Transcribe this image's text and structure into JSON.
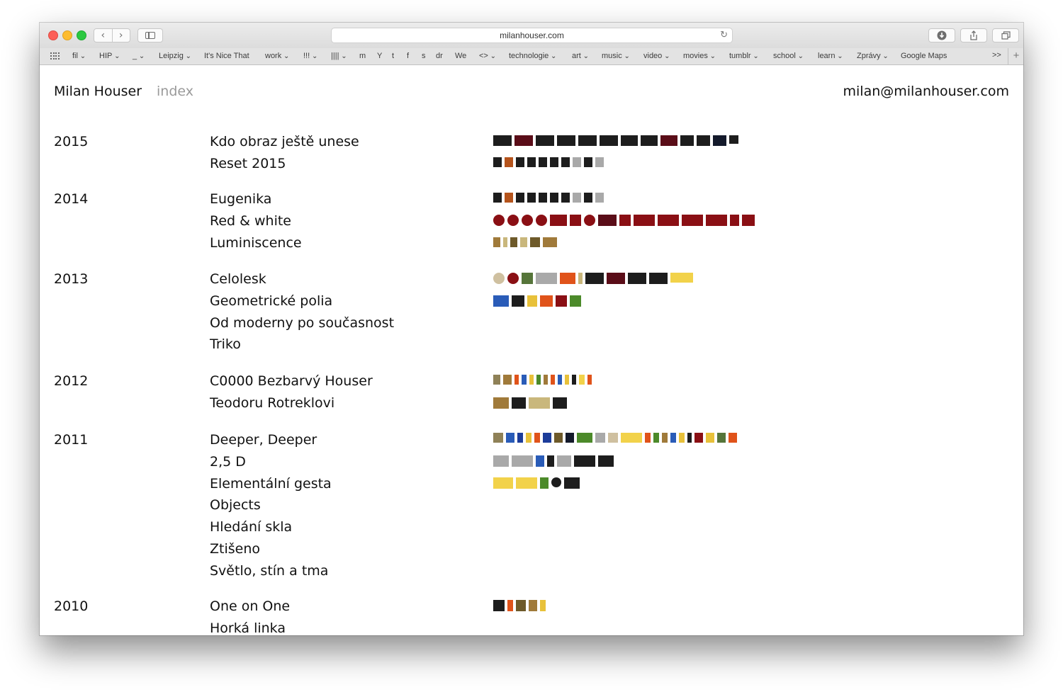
{
  "browser": {
    "url": "milanhouser.com",
    "bookmarks": [
      {
        "label": "fil",
        "dropdown": true
      },
      {
        "label": "HIP",
        "dropdown": true
      },
      {
        "label": "_",
        "dropdown": true
      },
      {
        "label": "Leipzig",
        "dropdown": true
      },
      {
        "label": "It's Nice That",
        "dropdown": false
      },
      {
        "label": "work",
        "dropdown": true
      },
      {
        "label": "!!!",
        "dropdown": true
      },
      {
        "label": "||||",
        "dropdown": true
      },
      {
        "label": "m",
        "dropdown": false
      },
      {
        "label": "Y",
        "dropdown": false
      },
      {
        "label": "t",
        "dropdown": false
      },
      {
        "label": "f",
        "dropdown": false
      },
      {
        "label": "s",
        "dropdown": false
      },
      {
        "label": "dr",
        "dropdown": false
      },
      {
        "label": "We",
        "dropdown": false
      },
      {
        "label": "<>",
        "dropdown": true
      },
      {
        "label": "technologie",
        "dropdown": true
      },
      {
        "label": "art",
        "dropdown": true
      },
      {
        "label": "music",
        "dropdown": true
      },
      {
        "label": "video",
        "dropdown": true
      },
      {
        "label": "movies",
        "dropdown": true
      },
      {
        "label": "tumblr",
        "dropdown": true
      },
      {
        "label": "school",
        "dropdown": true
      },
      {
        "label": "learn",
        "dropdown": true
      },
      {
        "label": "Zprávy",
        "dropdown": true
      },
      {
        "label": "Google Maps",
        "dropdown": false
      }
    ],
    "bookmarks_more": ">>",
    "icons": [
      "chevron-left-icon",
      "chevron-right-icon",
      "sidebar-icon",
      "reload-icon",
      "download-icon",
      "share-icon",
      "tabs-icon",
      "apps-grid-icon",
      "plus-icon"
    ]
  },
  "site": {
    "name": "Milan Houser",
    "nav": "index",
    "email": "milan@milanhouser.com"
  },
  "years": [
    {
      "year": "2015",
      "projects": [
        "Kdo obraz ještě unese",
        "Reset 2015"
      ]
    },
    {
      "year": "2014",
      "projects": [
        "Eugenika",
        "Red & white",
        "Luminiscence"
      ]
    },
    {
      "year": "2013",
      "projects": [
        "Celolesk",
        "Geometrické polia",
        "Od moderny po současnost",
        "Triko"
      ]
    },
    {
      "year": "2012",
      "projects": [
        "C0000 Bezbarvý Houser",
        "Teodoru Rotreklovi"
      ]
    },
    {
      "year": "2011",
      "projects": [
        "Deeper, Deeper",
        "2,5 D",
        "Elementální gesta",
        "Objects",
        "Hledání skla",
        "Ztišeno",
        "Světlo, stín a tma"
      ]
    },
    {
      "year": "2010",
      "projects": [
        "One on One",
        "Horká linka"
      ]
    }
  ]
}
